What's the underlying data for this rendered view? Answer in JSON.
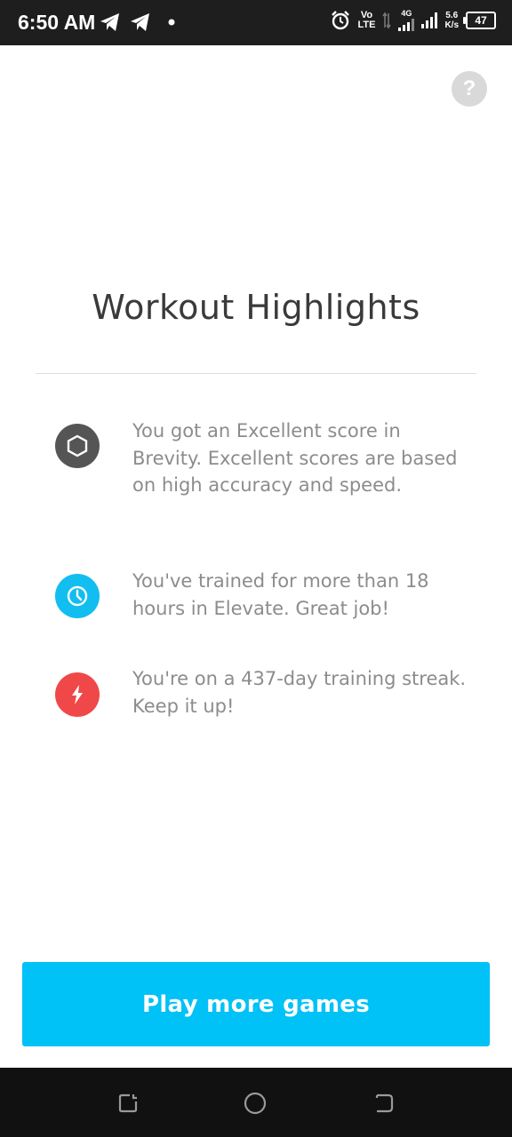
{
  "status_bar": {
    "time": "6:50 AM",
    "network_top": "Vo",
    "network_bottom": "LTE",
    "network_type": "4G",
    "speed_value": "5.6",
    "speed_unit": "K/s",
    "battery": "47",
    "icons": [
      "telegram-icon",
      "telegram-icon",
      "dot-icon",
      "alarm-icon",
      "signal-icon",
      "battery-icon"
    ]
  },
  "help": {
    "label": "?"
  },
  "title": "Workout Highlights",
  "highlights": [
    {
      "icon": "hexagon-icon",
      "color": "#555555",
      "text": "You got an Excellent score in Brevity. Excellent scores are based on high accuracy and speed."
    },
    {
      "icon": "clock-icon",
      "color": "#12bdf0",
      "text": "You've trained for more than 18 hours in Elevate. Great job!"
    },
    {
      "icon": "lightning-icon",
      "color": "#f04848",
      "text": "You're on a 437-day training streak. Keep it up!"
    }
  ],
  "cta": {
    "label": "Play more games"
  },
  "nav": {
    "icons": [
      "recents-icon",
      "home-icon",
      "back-icon"
    ]
  }
}
